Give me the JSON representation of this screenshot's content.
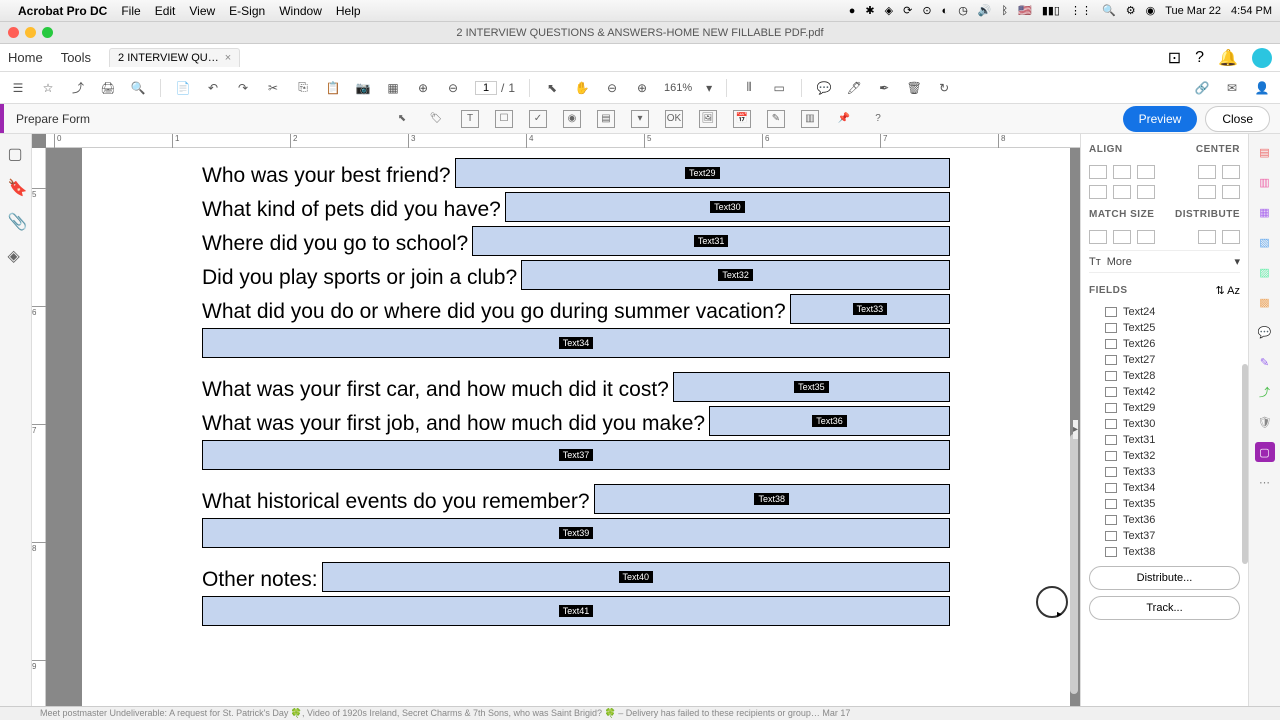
{
  "menubar": {
    "app_name": "Acrobat Pro DC",
    "items": [
      "File",
      "Edit",
      "View",
      "E-Sign",
      "Window",
      "Help"
    ],
    "right": {
      "flag": "🇺🇸",
      "battery": "▮▮▯",
      "day": "Tue Mar 22",
      "time": "4:54 PM"
    }
  },
  "titlebar": {
    "doc_title": "2 INTERVIEW QUESTIONS & ANSWERS-HOME NEW FILLABLE PDF.pdf"
  },
  "tabs": {
    "home": "Home",
    "tools": "Tools",
    "doc_tab": "2 INTERVIEW QU…"
  },
  "main_toolbar": {
    "page_current": "1",
    "page_total": "1",
    "zoom": "161%"
  },
  "form_toolbar": {
    "label": "Prepare Form",
    "preview": "Preview",
    "close": "Close"
  },
  "hruler_ticks": [
    {
      "pos": 8,
      "label": "0"
    },
    {
      "pos": 126,
      "label": "1"
    },
    {
      "pos": 244,
      "label": "2"
    },
    {
      "pos": 362,
      "label": "3"
    },
    {
      "pos": 480,
      "label": "4"
    },
    {
      "pos": 598,
      "label": "5"
    },
    {
      "pos": 716,
      "label": "6"
    },
    {
      "pos": 834,
      "label": "7"
    },
    {
      "pos": 952,
      "label": "8"
    }
  ],
  "vruler_ticks": [
    {
      "pos": 40,
      "label": "5"
    },
    {
      "pos": 158,
      "label": "6"
    },
    {
      "pos": 276,
      "label": "7"
    },
    {
      "pos": 394,
      "label": "8"
    },
    {
      "pos": 512,
      "label": "9"
    }
  ],
  "questions": [
    {
      "text": "Who was your best friend?",
      "field": "Text29"
    },
    {
      "text": "What kind of pets did you have?",
      "field": "Text30"
    },
    {
      "text": "Where did you go to school?",
      "field": "Text31"
    },
    {
      "text": "Did you play sports or join a club?",
      "field": "Text32"
    }
  ],
  "q_vacation": {
    "text": "What did you do or where did you go during summer vacation?",
    "field1": "Text33",
    "field2": "Text34"
  },
  "q_car": {
    "text": "What was your first car, and how much did it cost?",
    "field": "Text35"
  },
  "q_job": {
    "text": "What was your first job, and how much did you make?",
    "field1": "Text36",
    "field2": "Text37"
  },
  "q_hist": {
    "text": "What historical events do you remember?",
    "field1": "Text38",
    "field2": "Text39"
  },
  "q_notes": {
    "text": "Other notes:",
    "field1": "Text40",
    "field2": "Text41"
  },
  "right_panel": {
    "align": "ALIGN",
    "center": "CENTER",
    "match_size": "MATCH SIZE",
    "distribute_title": "DISTRIBUTE",
    "more": "More",
    "fields_title": "FIELDS",
    "fields": [
      "Text24",
      "Text25",
      "Text26",
      "Text27",
      "Text28",
      "Text42",
      "Text29",
      "Text30",
      "Text31",
      "Text32",
      "Text33",
      "Text34",
      "Text35",
      "Text36",
      "Text37",
      "Text38"
    ],
    "distribute_btn": "Distribute...",
    "track_btn": "Track..."
  },
  "bottom_strip": "Meet     postmaster     Undeliverable: A request for St. Patrick's Day 🍀, Video of 1920s Ireland, Secret Charms & 7th Sons, who was Saint Brigid? 🍀 – Delivery has failed to these recipients or group…     Mar 17"
}
